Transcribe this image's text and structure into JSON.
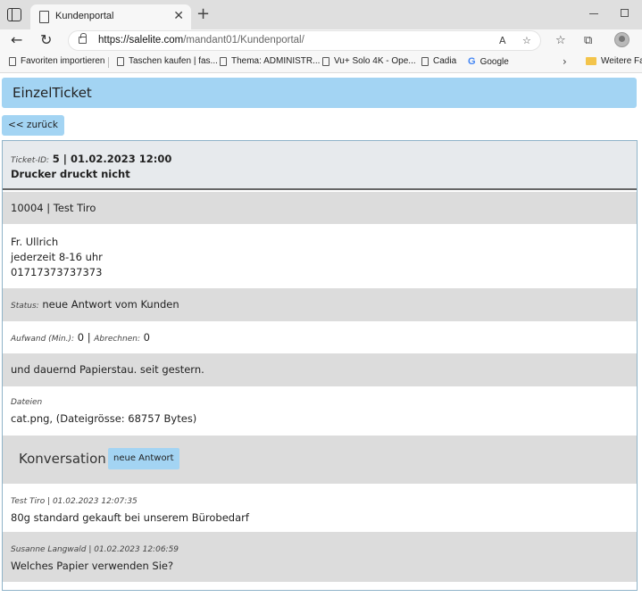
{
  "browser": {
    "tab_title": "Kundenportal",
    "url_host": "https://salelite.com",
    "url_path": "/mandant01/Kundenportal/",
    "favorites": [
      "Favoriten importieren",
      "Taschen kaufen | fas...",
      "Thema: ADMINISTR...",
      "Vu+ Solo 4K - Ope...",
      "Cadia",
      "Google",
      "Weitere Fav"
    ]
  },
  "page": {
    "title": "EinzelTicket",
    "back_label": "<< zurück"
  },
  "ticket": {
    "id_label": "Ticket-ID:",
    "id_value": "5 | 01.02.2023 12:00",
    "subject": "Drucker druckt nicht",
    "customer": "10004 | Test Tiro",
    "contact_lines": [
      "Fr. Ullrich",
      "jederzeit 8-16 uhr",
      "01717373737373"
    ],
    "status_label": "Status:",
    "status_value": "neue Antwort vom Kunden",
    "effort_label": "Aufwand (Min.):",
    "effort_value": "0",
    "effort_sep": "|",
    "billing_label": "Abrechnen:",
    "billing_value": "0",
    "description": "und dauernd Papierstau. seit gestern.",
    "files_label": "Dateien",
    "files_value": "cat.png, (Dateigrösse: 68757 Bytes)"
  },
  "conversation": {
    "title": "Konversation",
    "new_reply_label": "neue Antwort",
    "messages": [
      {
        "meta": "Test Tiro | 01.02.2023 12:07:35",
        "text": "80g standard gekauft bei unserem Bürobedarf"
      },
      {
        "meta": "Susanne Langwald | 01.02.2023 12:06:59",
        "text": "Welches Papier verwenden Sie?"
      }
    ]
  }
}
